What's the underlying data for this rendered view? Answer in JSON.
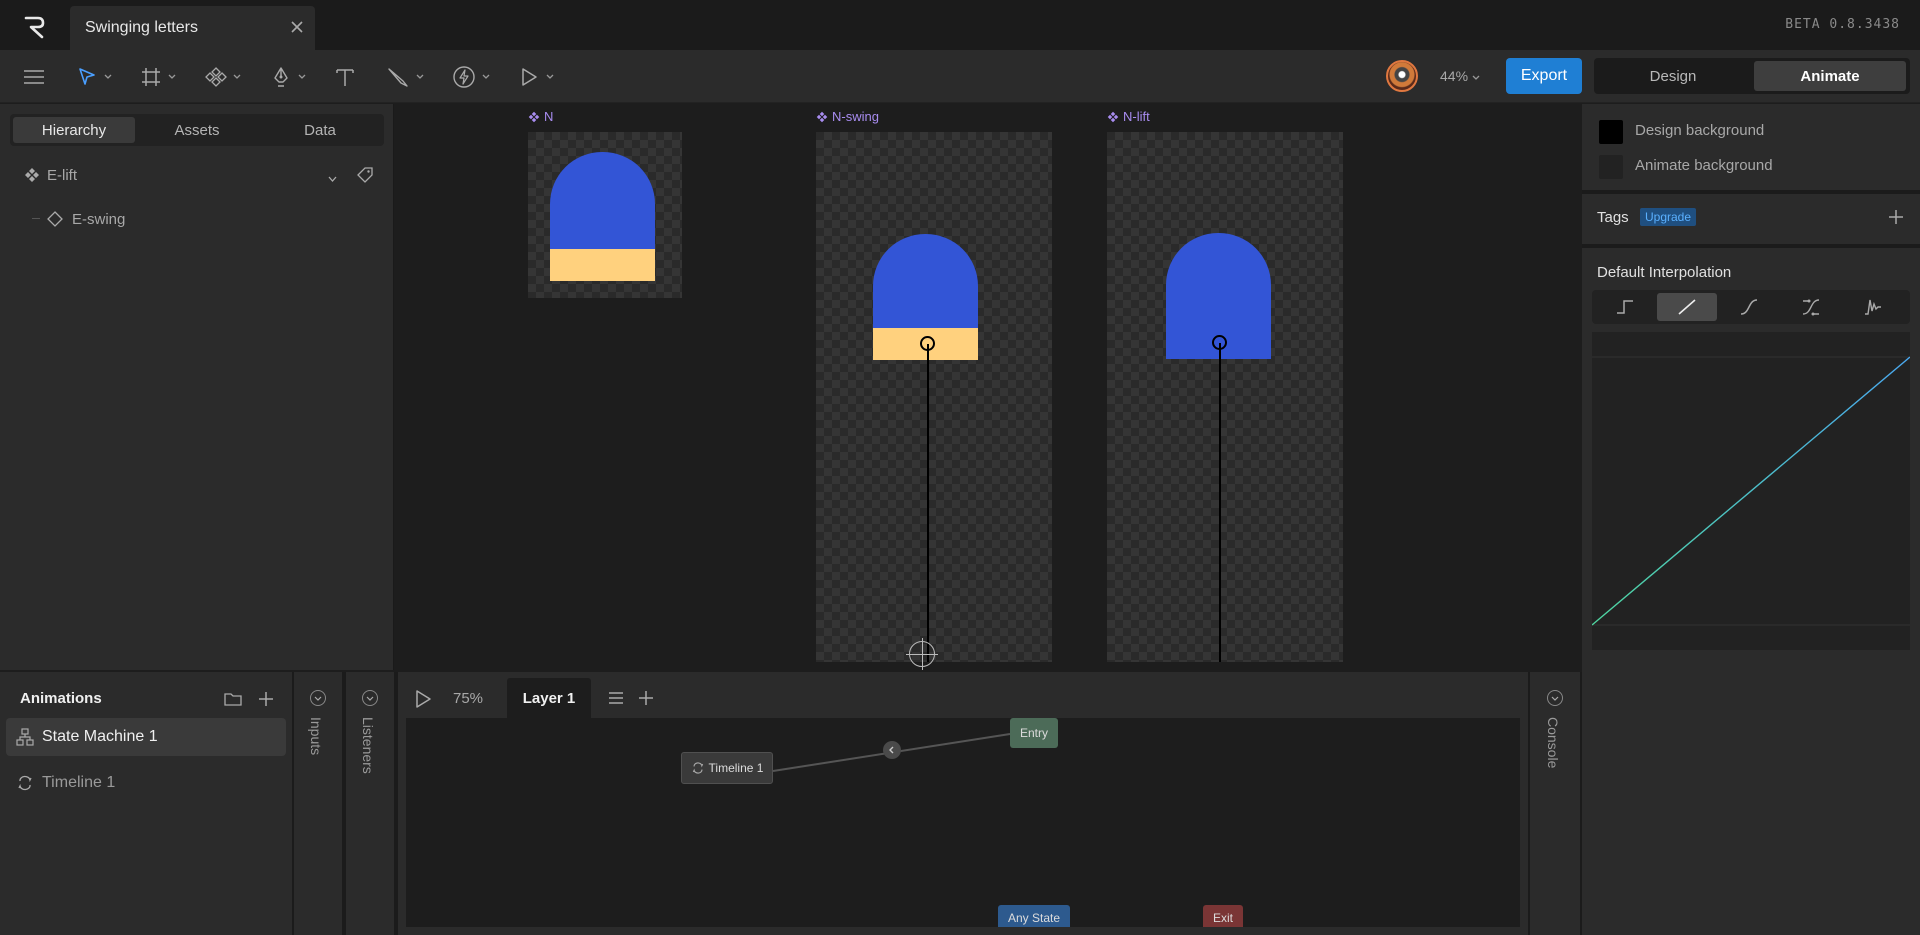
{
  "app": {
    "document_title": "Swinging letters",
    "version": "BETA 0.8.3438"
  },
  "toolbar": {
    "zoom": "44%",
    "export_label": "Export",
    "mode_design": "Design",
    "mode_animate": "Animate",
    "active_mode": "Animate",
    "tools": [
      "menu-icon",
      "select-icon",
      "artboard-icon",
      "component-icon",
      "pen-icon",
      "text-icon",
      "brush-icon",
      "lightning-icon",
      "play-icon"
    ]
  },
  "left_panel": {
    "tabs": [
      "Hierarchy",
      "Assets",
      "Data"
    ],
    "active_tab": "Hierarchy",
    "items": [
      {
        "label": "E-lift",
        "icon": "component-icon"
      },
      {
        "label": "E-swing",
        "icon": "diamond-icon"
      }
    ]
  },
  "canvas": {
    "artboards": [
      {
        "label": "N"
      },
      {
        "label": "N-swing"
      },
      {
        "label": "N-lift"
      }
    ],
    "colors": {
      "letter": "#3355d6",
      "bar": "#ffd17e",
      "label": "#a88cf0"
    }
  },
  "right_panel": {
    "design_background": "Design background",
    "animate_background": "Animate background",
    "tags_label": "Tags",
    "upgrade_label": "Upgrade",
    "interp_title": "Default Interpolation",
    "interp_options": [
      "hold-icon",
      "linear-icon",
      "cubic-icon",
      "ease-icon",
      "elastic-icon"
    ],
    "active_interp": "linear-icon"
  },
  "animations": {
    "title": "Animations",
    "items": [
      {
        "label": "State Machine 1",
        "icon": "state-machine-icon",
        "selected": true
      },
      {
        "label": "Timeline 1",
        "icon": "loop-icon",
        "selected": false
      }
    ],
    "inputs_label": "Inputs",
    "listeners_label": "Listeners"
  },
  "state_machine": {
    "zoom": "75%",
    "layer_tab": "Layer 1",
    "nodes": [
      {
        "label": "Entry",
        "color": "#4c6b58"
      },
      {
        "label": "Timeline 1",
        "color": "#3a3a3a"
      },
      {
        "label": "Any State",
        "color": "#2d5a8e"
      },
      {
        "label": "Exit",
        "color": "#7a3535"
      }
    ],
    "console_label": "Console"
  }
}
